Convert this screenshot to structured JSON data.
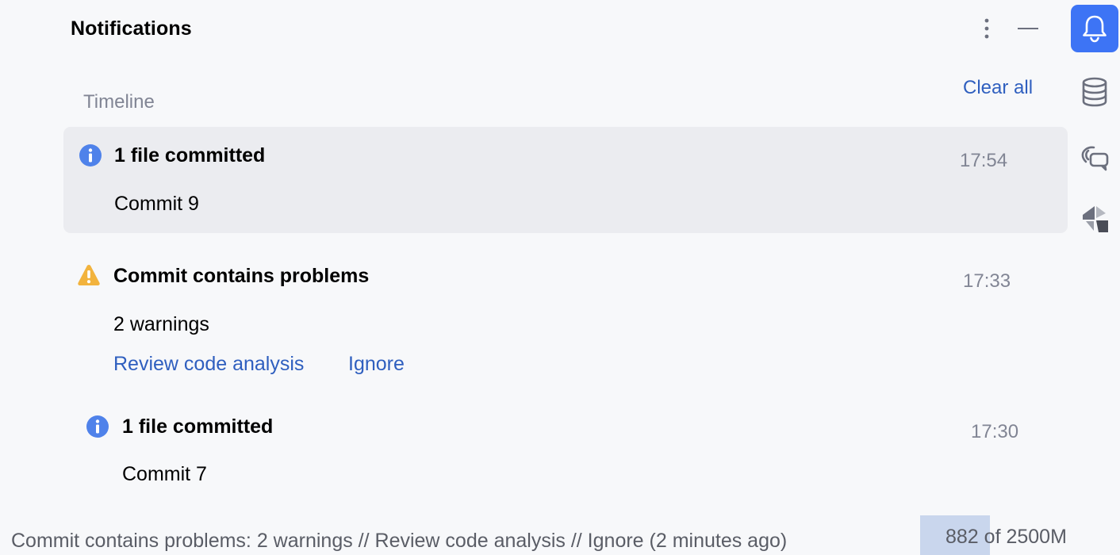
{
  "header": {
    "title": "Notifications"
  },
  "toolbar": {
    "more_icon": "more-vertical-icon",
    "minimize_icon": "minimize-icon",
    "clear_all_label": "Clear all"
  },
  "right_tool_windows": [
    {
      "icon": "bell-icon",
      "active": true
    },
    {
      "icon": "database-icon",
      "active": false
    },
    {
      "icon": "ai-chat-icon",
      "active": false
    },
    {
      "icon": "plugin-logo-icon",
      "active": false
    }
  ],
  "timeline": {
    "label": "Timeline",
    "notifications": [
      {
        "type": "info",
        "icon": "info-icon",
        "title": "1 file committed",
        "time": "17:54",
        "body": "Commit 9",
        "selected": true,
        "actions": []
      },
      {
        "type": "warning",
        "icon": "warning-icon",
        "title": "Commit contains problems",
        "time": "17:33",
        "body": "2 warnings",
        "selected": false,
        "actions": [
          "Review code analysis",
          "Ignore"
        ]
      },
      {
        "type": "info",
        "icon": "info-icon",
        "title": "1 file committed",
        "time": "17:30",
        "body": "Commit 7",
        "selected": false,
        "actions": []
      }
    ]
  },
  "status_bar": {
    "message": "Commit contains problems: 2 warnings // Review code analysis // Ignore (2 minutes ago)",
    "memory_used": "882",
    "memory_total_label": "of 2500M",
    "memory_fraction": 0.353
  },
  "colors": {
    "background": "#f7f8fa",
    "selected_card": "#ebecf0",
    "accent": "#3d74f5",
    "link": "#2f5fbf",
    "info": "#4f82ea",
    "warning": "#f2b33d",
    "muted_text": "#818594",
    "memory_fill": "#c9d6ed"
  }
}
